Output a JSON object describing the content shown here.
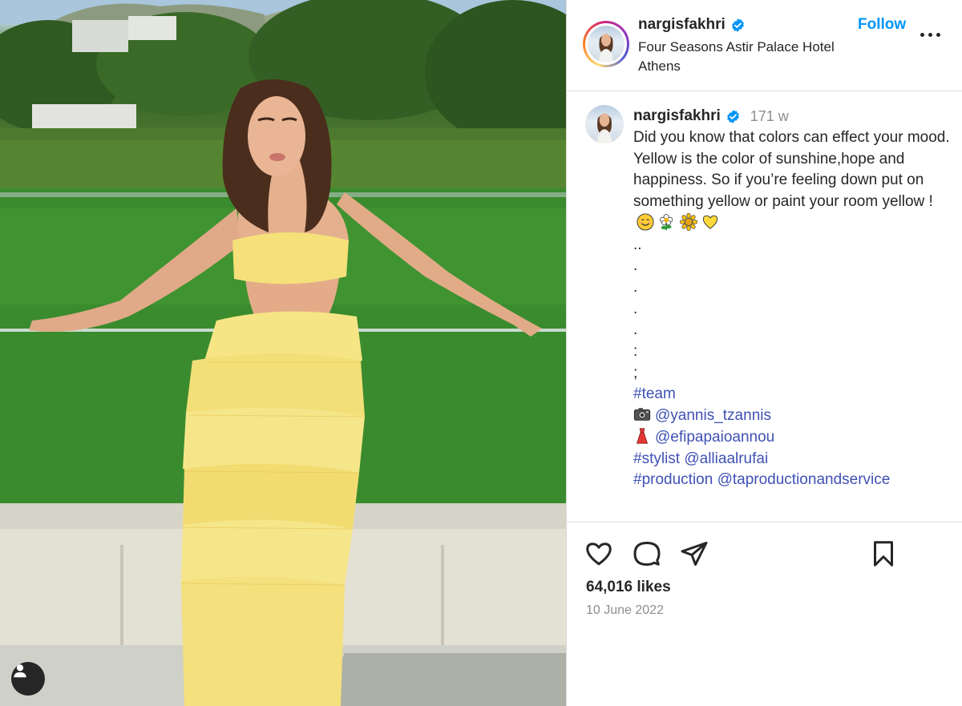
{
  "post": {
    "username": "nargisfakhri",
    "location": "Four Seasons Astir Palace Hotel Athens",
    "follow_label": "Follow",
    "time_ago": "171 w",
    "caption_lines": [
      "Did you know that colors can effect your mood.",
      "Yellow is the color of sunshine,hope and happiness. So if you’re feeling down put on something yellow or paint your room yellow !",
      "..",
      ".",
      ".",
      ".",
      ".",
      ":",
      ";"
    ],
    "hashtag_team": "#team",
    "photo_credit": "@yannis_tzannis",
    "dress_credit": "@efipapaioannou",
    "stylist_tag": "#stylist",
    "stylist_handle": "@alliaalrufai",
    "production_tag": "#production",
    "production_handle": "@taproductionandservice",
    "likes": "64,016 likes",
    "date": "10 June 2022"
  },
  "icons": {
    "like": "heart-icon",
    "comment": "comment-icon",
    "share": "paper-plane-icon",
    "save": "bookmark-icon",
    "more": "more-options-icon",
    "verified": "verified-badge-icon",
    "tagged": "user-tag-icon"
  },
  "colors": {
    "link_blue": "#0095f6",
    "hashtag_blue": "#3f51b5",
    "verified_blue": "#0095f6",
    "muted_text": "#8e8e8e",
    "divider": "#dbdbdb"
  }
}
